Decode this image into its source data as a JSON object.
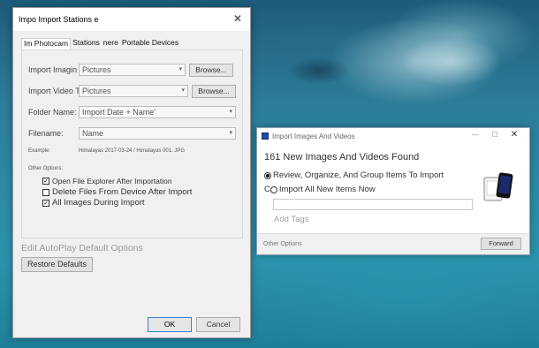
{
  "settings_dialog": {
    "title": "Impo Import Stations e",
    "close_glyph": "✕",
    "tabs": [
      "Im Photocam",
      "Stations",
      "nere",
      "Portable Devices"
    ],
    "rows": {
      "images_label": "Import Imagin",
      "images_value": "Pictures",
      "videos_label": "Import Video To:",
      "videos_value": "Pictures",
      "browse": "Browse...",
      "folder_label": "Folder Name:",
      "folder_value": "Import Date + Name'",
      "filename_label": "Filename:",
      "filename_value": "Name",
      "example_label": "Example:",
      "example_value": "Himalayas 2017-03-24 / Himalayas 001. JPG"
    },
    "other_options_label": "Other Options:",
    "options": [
      {
        "label": "Open File Explorer After Importation",
        "checked": true
      },
      {
        "label": "Delete Files From Device After Import",
        "checked": false
      },
      {
        "label": "All Images During Import",
        "checked": true
      }
    ],
    "edit_autoplay": "Edit AutoPlay Default Options",
    "restore_defaults": "Restore Defaults",
    "ok": "OK",
    "cancel": "Cancel"
  },
  "import_window": {
    "title": "Import Images And Videos",
    "controls": {
      "minimize": "—",
      "maximize": "☐",
      "close": "✕"
    },
    "heading": "161 New Images And Videos Found",
    "radio_review": "Review, Organize, And Group Items To Import",
    "radio_import_all": "Import All New Items Now",
    "radio_import_all_prefix": "C",
    "add_tags": "Add Tags",
    "other_options": "Other Options",
    "forward": "Forward",
    "phone_screen_color": "#1a2a6a",
    "device_icon": "devices-icon"
  }
}
